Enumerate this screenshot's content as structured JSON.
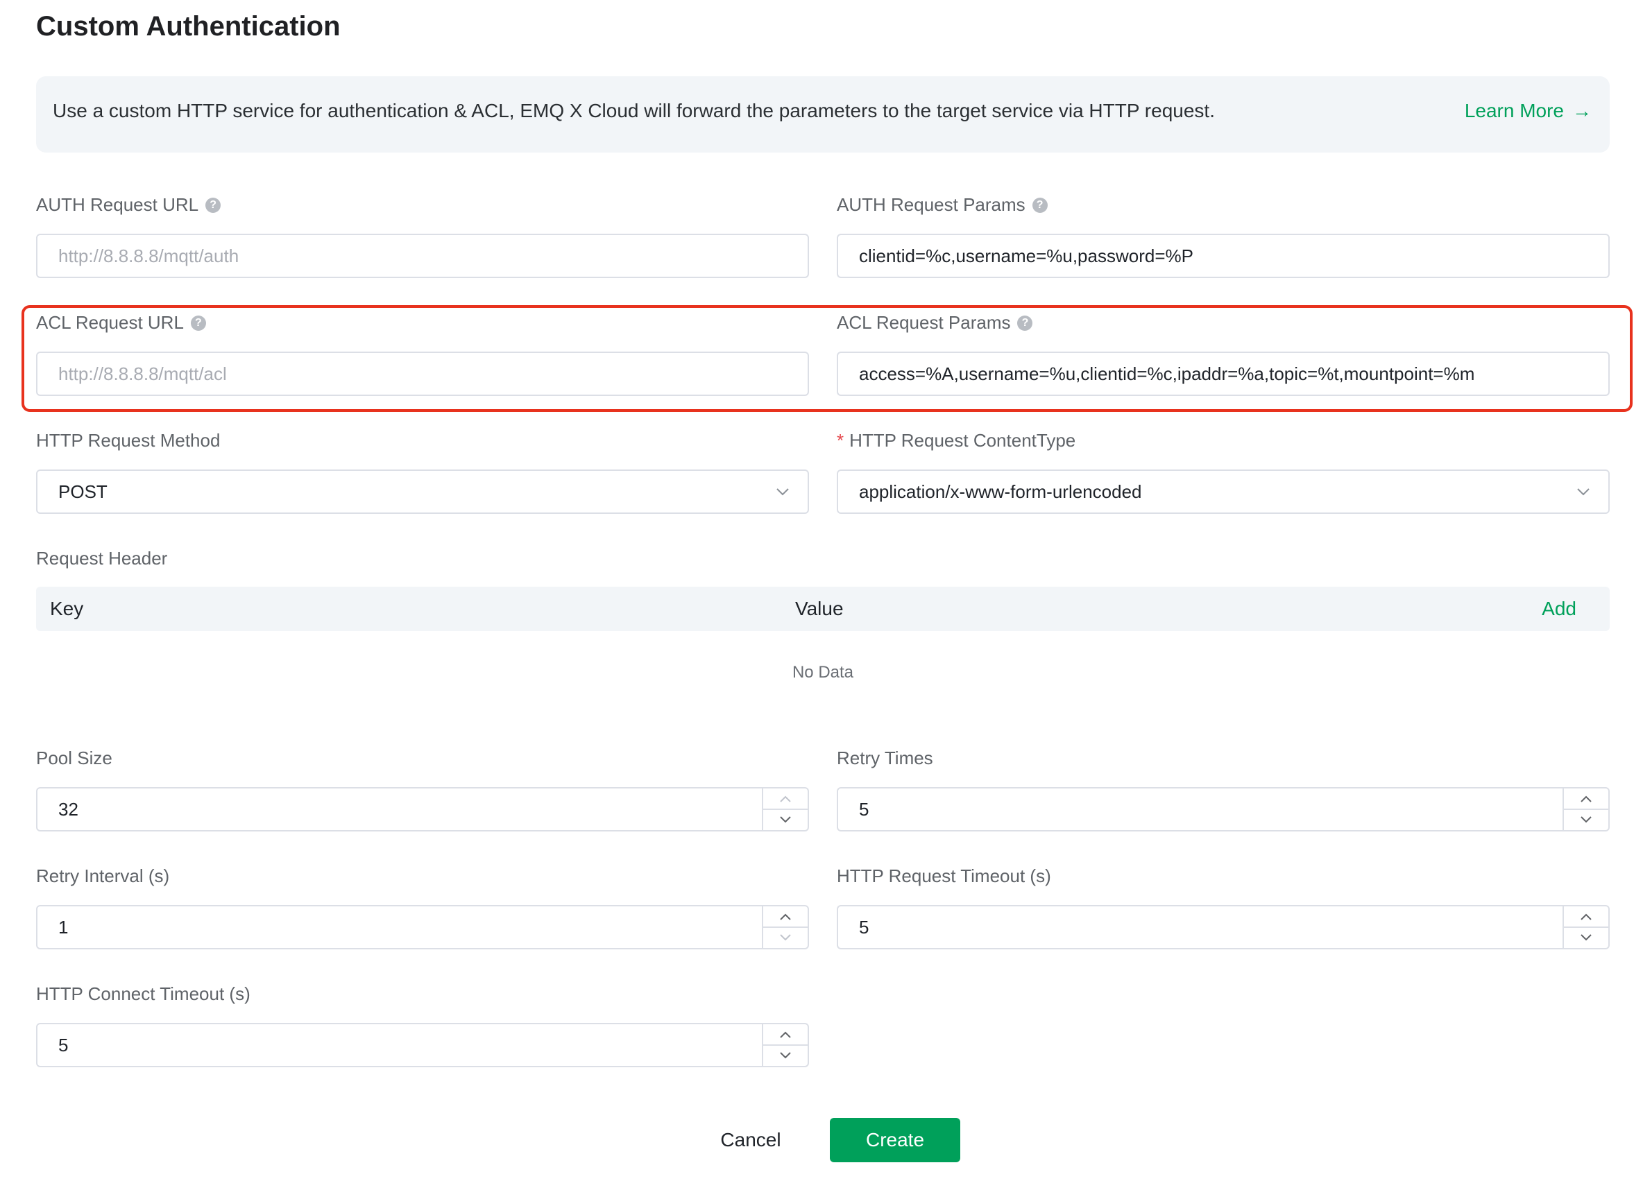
{
  "page": {
    "title": "Custom Authentication"
  },
  "notice": {
    "text": "Use a custom HTTP service for authentication & ACL, EMQ X Cloud will forward the parameters to the target service via HTTP request.",
    "link_label": "Learn More",
    "link_arrow": "→"
  },
  "fields": {
    "auth_url": {
      "label": "AUTH Request URL",
      "placeholder": "http://8.8.8.8/mqtt/auth",
      "value": ""
    },
    "auth_params": {
      "label": "AUTH Request Params",
      "value": "clientid=%c,username=%u,password=%P"
    },
    "acl_url": {
      "label": "ACL Request URL",
      "placeholder": "http://8.8.8.8/mqtt/acl",
      "value": ""
    },
    "acl_params": {
      "label": "ACL Request Params",
      "value": "access=%A,username=%u,clientid=%c,ipaddr=%a,topic=%t,mountpoint=%m"
    },
    "method": {
      "label": "HTTP Request Method",
      "value": "POST"
    },
    "content_type": {
      "required_mark": "*",
      "label": "HTTP Request ContentType",
      "value": "application/x-www-form-urlencoded"
    },
    "pool_size": {
      "label": "Pool Size",
      "value": "32"
    },
    "retry_times": {
      "label": "Retry Times",
      "value": "5"
    },
    "retry_interval": {
      "label": "Retry Interval (s)",
      "value": "1"
    },
    "request_timeout": {
      "label": "HTTP Request Timeout (s)",
      "value": "5"
    },
    "connect_timeout": {
      "label": "HTTP Connect Timeout (s)",
      "value": "5"
    }
  },
  "request_header": {
    "label": "Request Header",
    "columns": [
      "Key",
      "Value"
    ],
    "add_label": "Add",
    "empty_text": "No Data"
  },
  "actions": {
    "cancel_label": "Cancel",
    "create_label": "Create"
  },
  "colors": {
    "accent": "#00a05a",
    "highlight": "#e8321e"
  }
}
